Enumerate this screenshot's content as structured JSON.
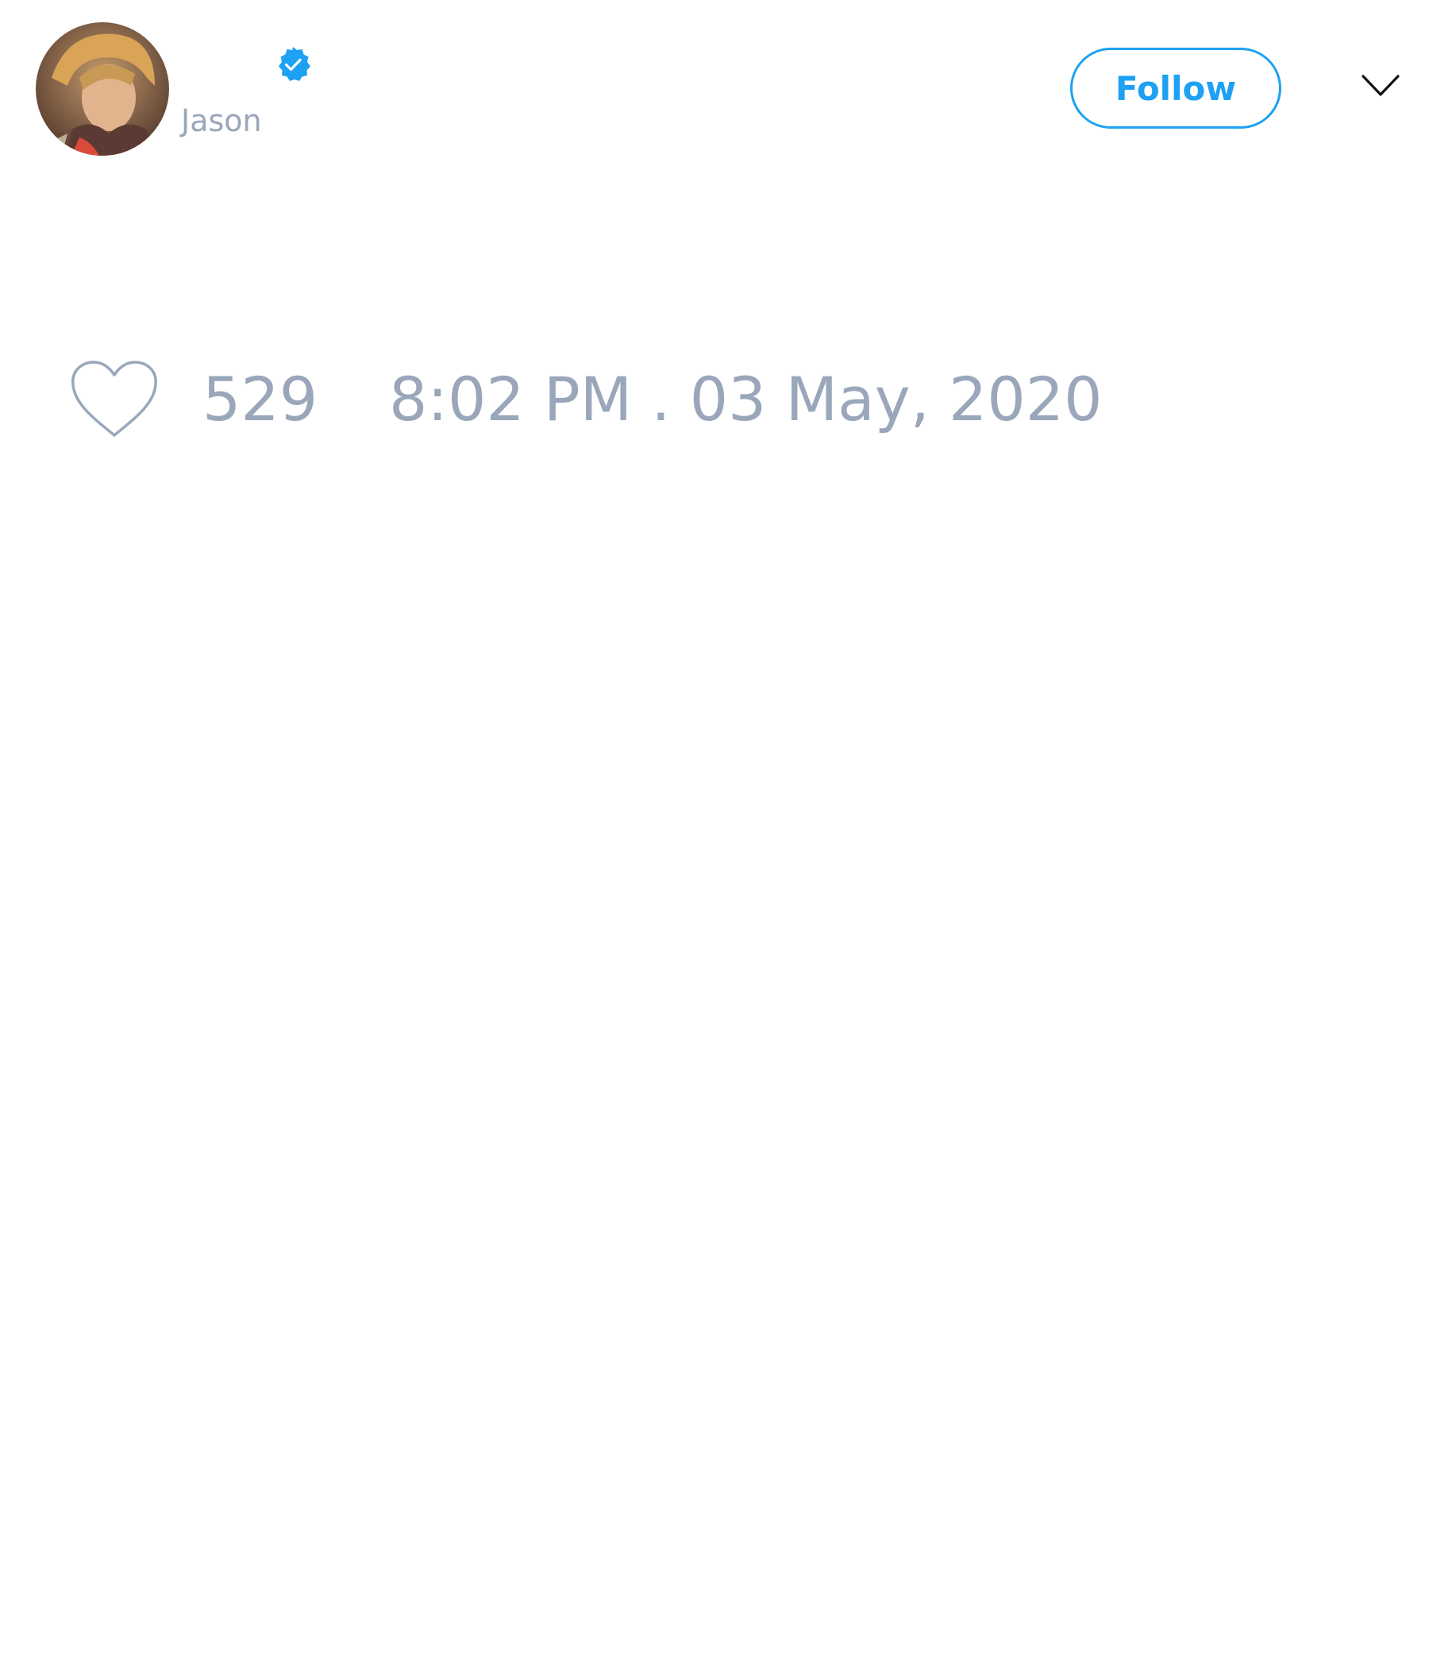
{
  "theme": {
    "accent": "#1da1f2",
    "muted_text": "#9aa7ba",
    "caret_color": "#111111",
    "heart_stroke": "#9aa7ba"
  },
  "header": {
    "avatar_icon": "user-photo",
    "verified_icon": "verified-badge-icon",
    "handle": "Jason",
    "follow_label": "Follow",
    "menu_icon": "chevron-down-icon"
  },
  "footer": {
    "like_icon": "heart-icon",
    "like_count": "529",
    "timestamp": "8:02 PM . 03 May, 2020"
  }
}
